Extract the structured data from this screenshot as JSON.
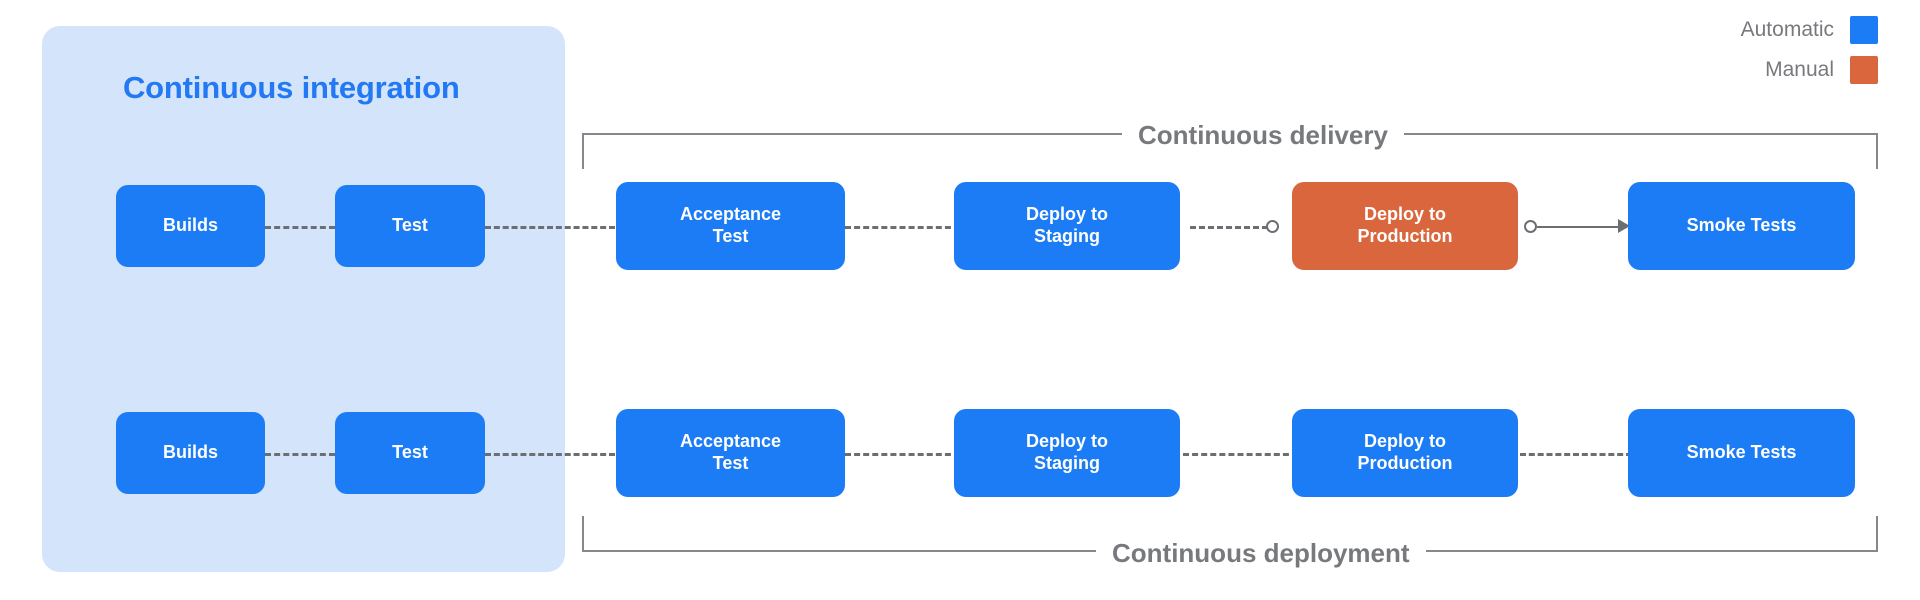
{
  "legend": {
    "items": [
      {
        "label": "Automatic",
        "color": "#1b7cf5",
        "icon": "color-swatch-icon"
      },
      {
        "label": "Manual",
        "color": "#d9663c",
        "icon": "color-swatch-icon"
      }
    ]
  },
  "ci_panel": {
    "title": "Continuous integration",
    "background_color": "#d4e4fb",
    "title_color": "#2279f3"
  },
  "brackets": {
    "top_label": "Continuous delivery",
    "bottom_label": "Continuous deployment",
    "line_color": "#85888c"
  },
  "pipelines": [
    {
      "name": "Continuous delivery",
      "stages": [
        {
          "label": "Builds",
          "type": "Automatic",
          "color": "#1b7cf5",
          "in_ci_panel": true
        },
        {
          "label": "Test",
          "type": "Automatic",
          "color": "#1b7cf5",
          "in_ci_panel": true
        },
        {
          "label": "Acceptance Test",
          "line1": "Acceptance",
          "line2": "Test",
          "type": "Automatic",
          "color": "#1b7cf5",
          "in_ci_panel": false
        },
        {
          "label": "Deploy to Staging",
          "line1": "Deploy to",
          "line2": "Staging",
          "type": "Automatic",
          "color": "#1b7cf5",
          "in_ci_panel": false
        },
        {
          "label": "Deploy to Production",
          "line1": "Deploy to",
          "line2": "Production",
          "type": "Manual",
          "color": "#d9663c",
          "in_ci_panel": false
        },
        {
          "label": "Smoke Tests",
          "type": "Automatic",
          "color": "#1b7cf5",
          "in_ci_panel": false
        }
      ],
      "connectors": [
        {
          "from": "Builds",
          "to": "Test",
          "style": "dashed"
        },
        {
          "from": "Test",
          "to": "Acceptance Test",
          "style": "dashed"
        },
        {
          "from": "Acceptance Test",
          "to": "Deploy to Staging",
          "style": "dashed"
        },
        {
          "from": "Deploy to Staging",
          "to": "Deploy to Production",
          "style": "dashed-gate"
        },
        {
          "from": "Deploy to Production",
          "to": "Smoke Tests",
          "style": "solid-gate-arrow"
        }
      ]
    },
    {
      "name": "Continuous deployment",
      "stages": [
        {
          "label": "Builds",
          "type": "Automatic",
          "color": "#1b7cf5",
          "in_ci_panel": true
        },
        {
          "label": "Test",
          "type": "Automatic",
          "color": "#1b7cf5",
          "in_ci_panel": true
        },
        {
          "label": "Acceptance Test",
          "line1": "Acceptance",
          "line2": "Test",
          "type": "Automatic",
          "color": "#1b7cf5",
          "in_ci_panel": false
        },
        {
          "label": "Deploy to Staging",
          "line1": "Deploy to",
          "line2": "Staging",
          "type": "Automatic",
          "color": "#1b7cf5",
          "in_ci_panel": false
        },
        {
          "label": "Deploy to Production",
          "line1": "Deploy to",
          "line2": "Production",
          "type": "Automatic",
          "color": "#1b7cf5",
          "in_ci_panel": false
        },
        {
          "label": "Smoke Tests",
          "type": "Automatic",
          "color": "#1b7cf5",
          "in_ci_panel": false
        }
      ],
      "connectors": [
        {
          "from": "Builds",
          "to": "Test",
          "style": "dashed"
        },
        {
          "from": "Test",
          "to": "Acceptance Test",
          "style": "dashed"
        },
        {
          "from": "Acceptance Test",
          "to": "Deploy to Staging",
          "style": "dashed"
        },
        {
          "from": "Deploy to Staging",
          "to": "Deploy to Production",
          "style": "dashed"
        },
        {
          "from": "Deploy to Production",
          "to": "Smoke Tests",
          "style": "dashed"
        }
      ]
    }
  ]
}
